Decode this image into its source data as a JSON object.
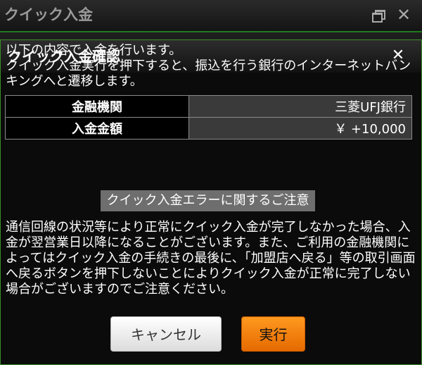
{
  "outer_window": {
    "title": "クイック入金",
    "close_label": "✕"
  },
  "dialog": {
    "title": "クイック入金確認",
    "close_label": "✕",
    "intro_line1": "以下の内容で入金を行います。",
    "intro_line2": "クイック入金実行を押下すると、振込を行う銀行のインターネットバンキングへと遷移します。",
    "table": [
      {
        "label": "金融機関",
        "value": "三菱UFJ銀行"
      },
      {
        "label": "入金金額",
        "value": "￥ +10,000"
      }
    ],
    "notice_title": "クイック入金エラーに関するご注意",
    "notice_body": "通信回線の状況等により正常にクイック入金が完了しなかった場合、入金が翌営業日以降になることがございます。また、ご利用の金融機関によってはクイック入金の手続きの最後に、「加盟店へ戻る」等の取引画面へ戻るボタンを押下しないことによりクイック入金が正常に完了しない場合がございますのでご注意ください。",
    "cancel_label": "キャンセル",
    "execute_label": "実行"
  },
  "colors": {
    "accent_green": "#3a8f2a",
    "execute_orange": "#f08010",
    "notice_bg": "#6e6e6e"
  }
}
